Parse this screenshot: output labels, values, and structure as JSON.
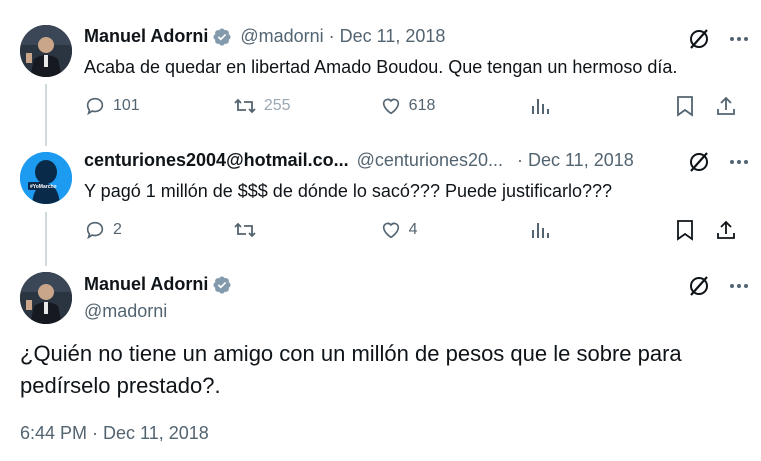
{
  "tweets": [
    {
      "name": "Manuel Adorni",
      "handle": "@madorni",
      "date": "Dec 11, 2018",
      "text": "Acaba de quedar en libertad Amado Boudou. Que tengan un hermoso día.",
      "replies": "101",
      "retweets": "255",
      "likes": "618",
      "avatar_icon": "person-photo-avatar"
    },
    {
      "name": "centuriones2004@hotmail.co...",
      "handle": "@centuriones20...",
      "date": "Dec 11, 2018",
      "text": "Y pagó 1 millón de $$$ de dónde lo sacó??? Puede justificarlo???",
      "replies": "2",
      "retweets": "",
      "likes": "4",
      "avatar_icon": "yomarcho-avatar",
      "avatar_badge": "#YoMarcho"
    }
  ],
  "main_tweet": {
    "name": "Manuel Adorni",
    "handle": "@madorni",
    "text_line1": "¿Quién no tiene un amigo con un millón de pesos que le sobre para",
    "text_line2": "pedírselo prestado?.",
    "timestamp": "6:44 PM · Dec 11, 2018"
  },
  "separator": "·",
  "colors": {
    "verified": "#829aab",
    "muted": "#536471",
    "text": "#0f1419",
    "line": "#cfd9de",
    "accent_blue": "#1d9bf0"
  }
}
